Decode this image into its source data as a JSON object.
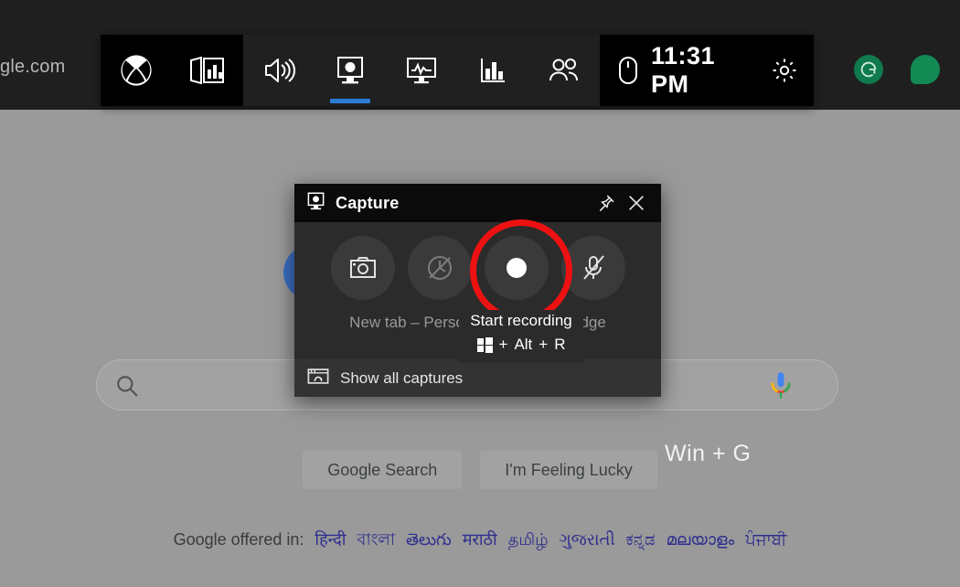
{
  "browser": {
    "url_text": "gle.com",
    "extensions": [
      {
        "name": "grammarly-extension-icon",
        "color": "#0f7a4d"
      },
      {
        "name": "green-dot-extension-icon",
        "color": "#138a54"
      }
    ]
  },
  "google_page": {
    "search_placeholder": "",
    "search_value": "",
    "buttons": [
      {
        "label": "Google Search",
        "name": "google-search-button"
      },
      {
        "label": "I'm Feeling Lucky",
        "name": "feeling-lucky-button"
      }
    ],
    "offered_label": "Google offered in:",
    "languages": [
      "हिन्दी",
      "বাংলা",
      "తెలుగు",
      "मराठी",
      "தமிழ்",
      "ગુજરાતી",
      "ಕನ್ನಡ",
      "മലയാളം",
      "ਪੰਜਾਬੀ"
    ]
  },
  "annotation": {
    "shortcut_hint": "Win + G",
    "ring_color": "#ee1111"
  },
  "gamebar": {
    "items": [
      {
        "name": "xbox-logo-icon",
        "label": "Xbox"
      },
      {
        "name": "widget-menu-icon",
        "label": "Widget menu"
      },
      {
        "name": "audio-icon",
        "label": "Audio"
      },
      {
        "name": "capture-icon",
        "label": "Capture",
        "active": true
      },
      {
        "name": "performance-icon",
        "label": "Performance"
      },
      {
        "name": "resources-icon",
        "label": "Resources"
      },
      {
        "name": "xbox-social-icon",
        "label": "Xbox Social"
      }
    ],
    "mouse_icon": "mouse-icon",
    "time": "11:31 PM",
    "settings_icon": "gear-icon",
    "accent_color": "#2b7cd3"
  },
  "capture_widget": {
    "title": "Capture",
    "title_icon": "capture-icon",
    "pin_label": "Pin",
    "close_label": "Close",
    "buttons": [
      {
        "name": "take-screenshot-button",
        "icon": "camera-icon",
        "enabled": true
      },
      {
        "name": "record-last-30-seconds-button",
        "icon": "record-last-disabled-icon",
        "enabled": false
      },
      {
        "name": "start-recording-button",
        "icon": "record-dot-icon",
        "enabled": true
      },
      {
        "name": "toggle-microphone-button",
        "icon": "microphone-muted-icon",
        "enabled": true
      }
    ],
    "caption": "New tab – Personal – Microsoft Edge",
    "show_all_captures": "Show all captures",
    "show_all_captures_icon": "gallery-icon"
  },
  "tooltip": {
    "title": "Start recording",
    "shortcut_sep1": "+",
    "shortcut_alt": "Alt",
    "shortcut_sep2": "+",
    "shortcut_key": "R",
    "win_icon": "windows-key-icon"
  }
}
